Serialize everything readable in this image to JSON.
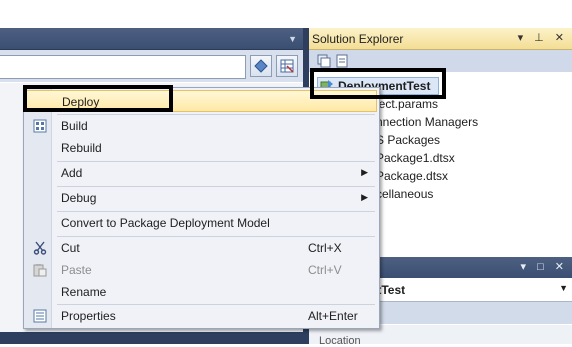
{
  "solution_explorer": {
    "title": "Solution Explorer",
    "header_glyphs": "▾ ⊥ ✕",
    "project": "DeploymentTest",
    "tree_items": [
      "ject.params",
      "nnection Managers",
      "S Packages",
      "Package1.dtsx",
      "Package.dtsx",
      "cellaneous"
    ]
  },
  "properties": {
    "header_glyphs": "▾ □ ✕",
    "selected_object": "ntTest",
    "category": "Location"
  },
  "context_menu": {
    "items": [
      {
        "label": "Deploy",
        "shortcut": "",
        "submenu": false,
        "disabled": false,
        "icon": "none"
      },
      {
        "label": "Build",
        "shortcut": "",
        "submenu": false,
        "disabled": false,
        "icon": "build-icon"
      },
      {
        "label": "Rebuild",
        "shortcut": "",
        "submenu": false,
        "disabled": false,
        "icon": "none"
      },
      {
        "label": "Add",
        "shortcut": "",
        "submenu": true,
        "disabled": false,
        "icon": "none"
      },
      {
        "label": "Debug",
        "shortcut": "",
        "submenu": true,
        "disabled": false,
        "icon": "none"
      },
      {
        "label": "Convert to Package Deployment Model",
        "shortcut": "",
        "submenu": false,
        "disabled": false,
        "icon": "none"
      },
      {
        "label": "Cut",
        "shortcut": "Ctrl+X",
        "submenu": false,
        "disabled": false,
        "icon": "scissors-icon"
      },
      {
        "label": "Paste",
        "shortcut": "Ctrl+V",
        "submenu": false,
        "disabled": true,
        "icon": "paste-icon"
      },
      {
        "label": "Rename",
        "shortcut": "",
        "submenu": false,
        "disabled": false,
        "icon": "none"
      },
      {
        "label": "Properties",
        "shortcut": "Alt+Enter",
        "submenu": false,
        "disabled": false,
        "icon": "properties-icon"
      }
    ]
  },
  "colors": {
    "header_dark": "#3b4f72",
    "se_header": "#f4de95",
    "menu_highlight": "#ffe9a6",
    "callout": "#000000"
  }
}
